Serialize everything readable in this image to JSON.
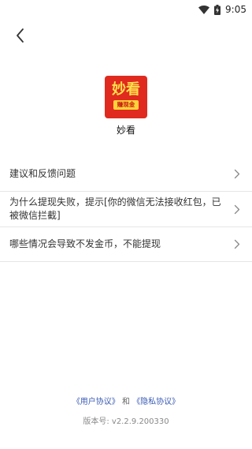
{
  "status_bar": {
    "time": "9:05",
    "wifi_icon": "wifi-icon",
    "battery_icon": "battery-charging-icon"
  },
  "header": {
    "back_icon": "back-arrow-icon"
  },
  "app": {
    "logo_main": "妙看",
    "logo_ribbon": "赚现金",
    "name": "妙看",
    "brand_colors": {
      "logo_bg": "#e02a1f",
      "logo_text": "#ffe14a",
      "ribbon_bg": "#ffd23a"
    }
  },
  "faq": {
    "items": [
      {
        "label": "建议和反馈问题"
      },
      {
        "label": "为什么提现失败，提示[你的微信无法接收红包，已被微信拦截]"
      },
      {
        "label": "哪些情况会导致不发金币，不能提现"
      }
    ],
    "chevron_icon": "chevron-right-icon"
  },
  "footer": {
    "user_agreement": "《用户协议》",
    "and_text": "和",
    "privacy_agreement": "《隐私协议》",
    "version": "版本号: v2.2.9.200330",
    "link_color": "#3a5bb5"
  }
}
